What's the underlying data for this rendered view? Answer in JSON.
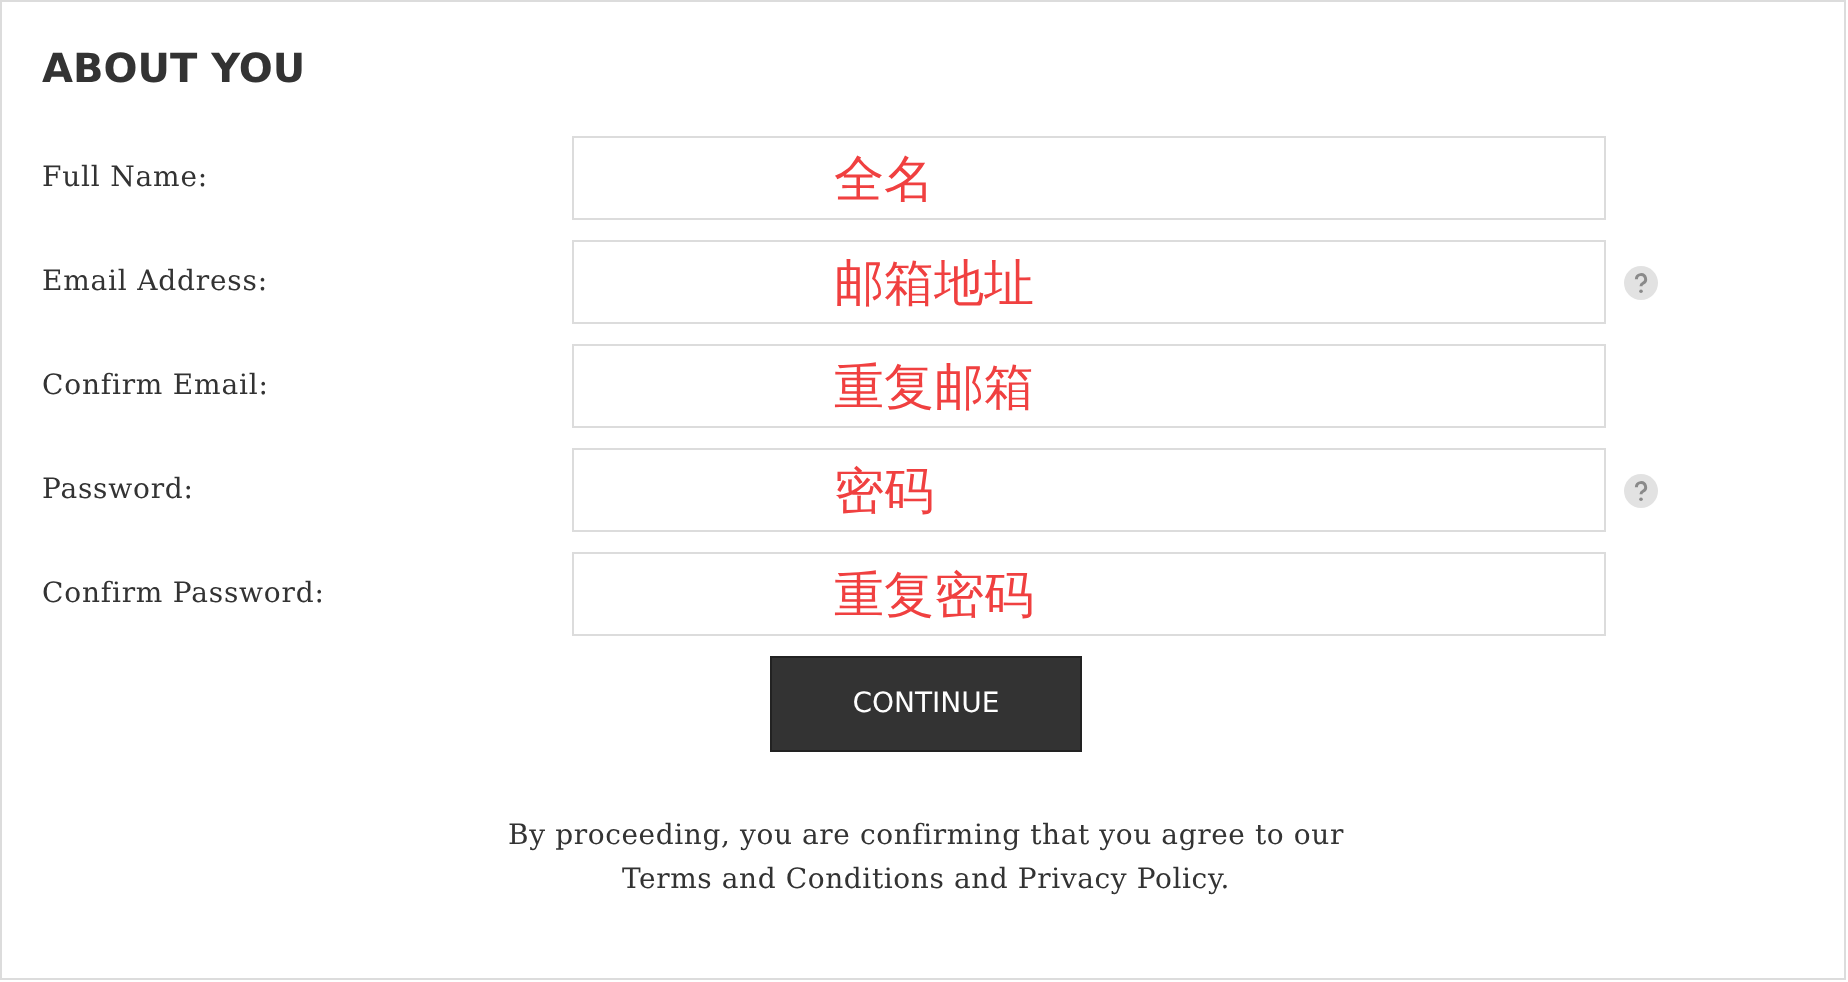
{
  "heading": "ABOUT YOU",
  "fields": [
    {
      "label": "Full Name:",
      "annotation": "全名",
      "help": false
    },
    {
      "label": "Email Address:",
      "annotation": "邮箱地址",
      "help": true
    },
    {
      "label": "Confirm Email:",
      "annotation": "重复邮箱",
      "help": false
    },
    {
      "label": "Password:",
      "annotation": "密码",
      "help": true
    },
    {
      "label": "Confirm Password:",
      "annotation": "重复密码",
      "help": false
    }
  ],
  "button": "CONTINUE",
  "terms": "By proceeding, you are confirming that you agree to our Terms and Conditions and Privacy Policy."
}
